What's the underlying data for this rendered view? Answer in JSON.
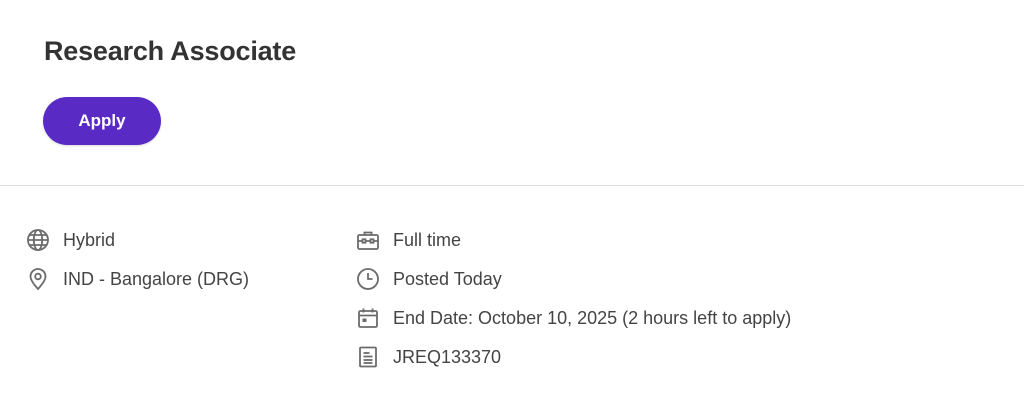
{
  "job": {
    "title": "Research Associate",
    "apply_label": "Apply"
  },
  "details": {
    "left": [
      {
        "icon": "globe-icon",
        "text": "Hybrid"
      },
      {
        "icon": "location-pin-icon",
        "text": "IND - Bangalore (DRG)"
      }
    ],
    "right": [
      {
        "icon": "briefcase-icon",
        "text": "Full time"
      },
      {
        "icon": "clock-icon",
        "text": "Posted Today"
      },
      {
        "icon": "calendar-icon",
        "text": "End Date: October 10, 2025 (2 hours left to apply)"
      },
      {
        "icon": "document-icon",
        "text": "JREQ133370"
      }
    ]
  },
  "colors": {
    "accent": "#5a2bc4",
    "icon": "#6b6b6b",
    "text": "#444444",
    "title": "#333333"
  }
}
